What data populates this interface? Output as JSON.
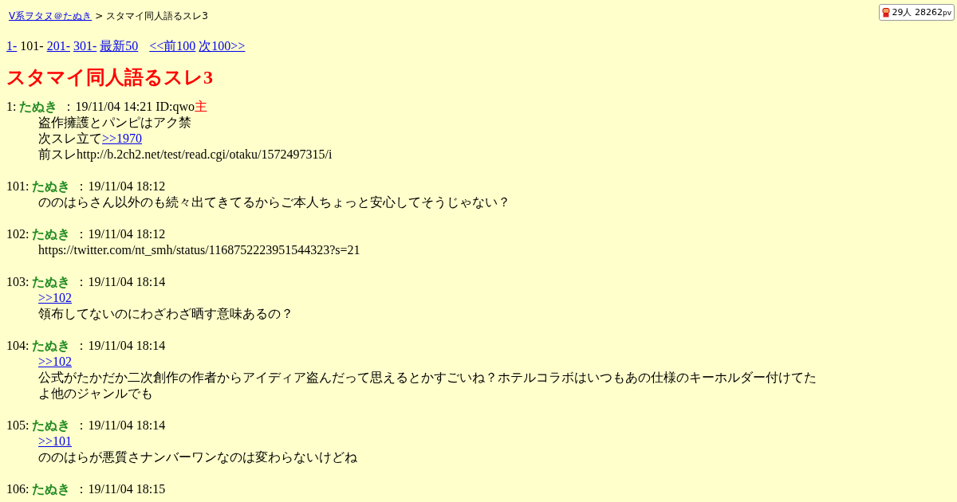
{
  "breadcrumb": {
    "board": "V系ヲタヌ＠たぬき",
    "separator": ">",
    "thread": "スタマイ同人語るスレ3"
  },
  "counter": {
    "text": "29人 28262",
    "unit": "pv"
  },
  "nav": [
    {
      "label": "1-",
      "kind": "link"
    },
    {
      "label": "101-",
      "kind": "current"
    },
    {
      "label": "201-",
      "kind": "link"
    },
    {
      "label": "301-",
      "kind": "link"
    },
    {
      "label": "最新50",
      "kind": "link"
    },
    {
      "label": "<<前100",
      "kind": "link"
    },
    {
      "label": "次100>>",
      "kind": "link"
    }
  ],
  "title": "スタマイ同人語るスレ3",
  "posts": [
    {
      "number": "1:",
      "name": "たぬき",
      "date": "：19/11/04 14:21 ID:qwo",
      "op_mark": "主",
      "body": [
        [
          {
            "kind": "text",
            "text": "盗作擁護とパンピはアク禁"
          }
        ],
        [
          {
            "kind": "text",
            "text": "次スレ立て"
          },
          {
            "kind": "link",
            "text": ">>1970"
          }
        ],
        [
          {
            "kind": "text",
            "text": "前スレhttp://b.2ch2.net/test/read.cgi/otaku/1572497315/i"
          }
        ]
      ]
    },
    {
      "number": "101:",
      "name": "たぬき",
      "date": "：19/11/04 18:12",
      "body": [
        [
          {
            "kind": "text",
            "text": "ののはらさん以外のも続々出てきてるからご本人ちょっと安心してそうじゃない？"
          }
        ]
      ]
    },
    {
      "number": "102:",
      "name": "たぬき",
      "date": "：19/11/04 18:12",
      "body": [
        [
          {
            "kind": "text",
            "text": "https://twitter.com/nt_smh/status/1168752223951544323?s=21"
          }
        ]
      ]
    },
    {
      "number": "103:",
      "name": "たぬき",
      "date": "：19/11/04 18:14",
      "body": [
        [
          {
            "kind": "link",
            "text": ">>102"
          }
        ],
        [
          {
            "kind": "text",
            "text": "領布してないのにわざわざ晒す意味あるの？"
          }
        ]
      ]
    },
    {
      "number": "104:",
      "name": "たぬき",
      "date": "：19/11/04 18:14",
      "body": [
        [
          {
            "kind": "link",
            "text": ">>102"
          }
        ],
        [
          {
            "kind": "text",
            "text": "公式がたかだか二次創作の作者からアイディア盗んだって思えるとかすごいね？ホテルコラボはいつもあの仕様のキーホルダー付けてたよ他のジャンルでも"
          }
        ]
      ]
    },
    {
      "number": "105:",
      "name": "たぬき",
      "date": "：19/11/04 18:14",
      "body": [
        [
          {
            "kind": "link",
            "text": ">>101"
          }
        ],
        [
          {
            "kind": "text",
            "text": "ののはらが悪質さナンバーワンなのは変わらないけどね"
          }
        ]
      ]
    },
    {
      "number": "106:",
      "name": "たぬき",
      "date": "：19/11/04 18:15"
    }
  ]
}
